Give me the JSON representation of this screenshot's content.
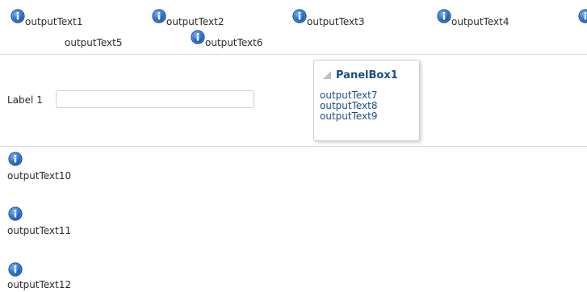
{
  "row1": {
    "items": [
      "outputText1",
      "outputText2",
      "outputText3",
      "outputText4"
    ],
    "second_line": [
      "outputText5",
      "outputText6"
    ]
  },
  "form": {
    "label": "Label 1",
    "input_value": ""
  },
  "panel_box": {
    "title": "PanelBox1",
    "items": [
      "outputText7",
      "outputText8",
      "outputText9"
    ]
  },
  "stack": {
    "items": [
      "outputText10",
      "outputText11",
      "outputText12"
    ]
  },
  "colors": {
    "icon_blue": "#2a6fc9",
    "panel_title": "#1b4e86",
    "divider": "#d9dde2"
  },
  "icons": {
    "info": "info-icon",
    "panel_toggle": "disclosure-triangle-icon"
  }
}
